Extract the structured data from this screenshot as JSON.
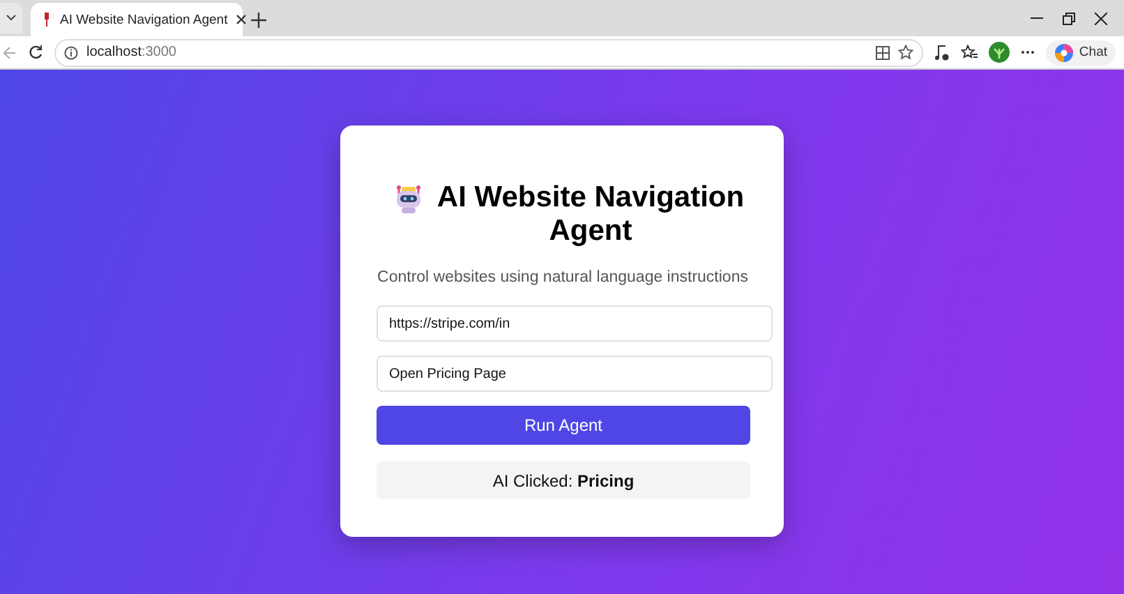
{
  "browser": {
    "tab": {
      "title": "AI Website Navigation Agent",
      "selected": true
    },
    "address": {
      "host": "localhost",
      "port": ":3000"
    },
    "chat_button": "Chat"
  },
  "card": {
    "title": "AI Website Navigation Agent",
    "subtitle": "Control websites using natural language instructions",
    "fields": [
      {
        "value": "https://stripe.com/in"
      },
      {
        "value": "Open Pricing Page"
      }
    ],
    "run_button": "Run Agent",
    "result": "AI Clicked: **Pricing**"
  }
}
